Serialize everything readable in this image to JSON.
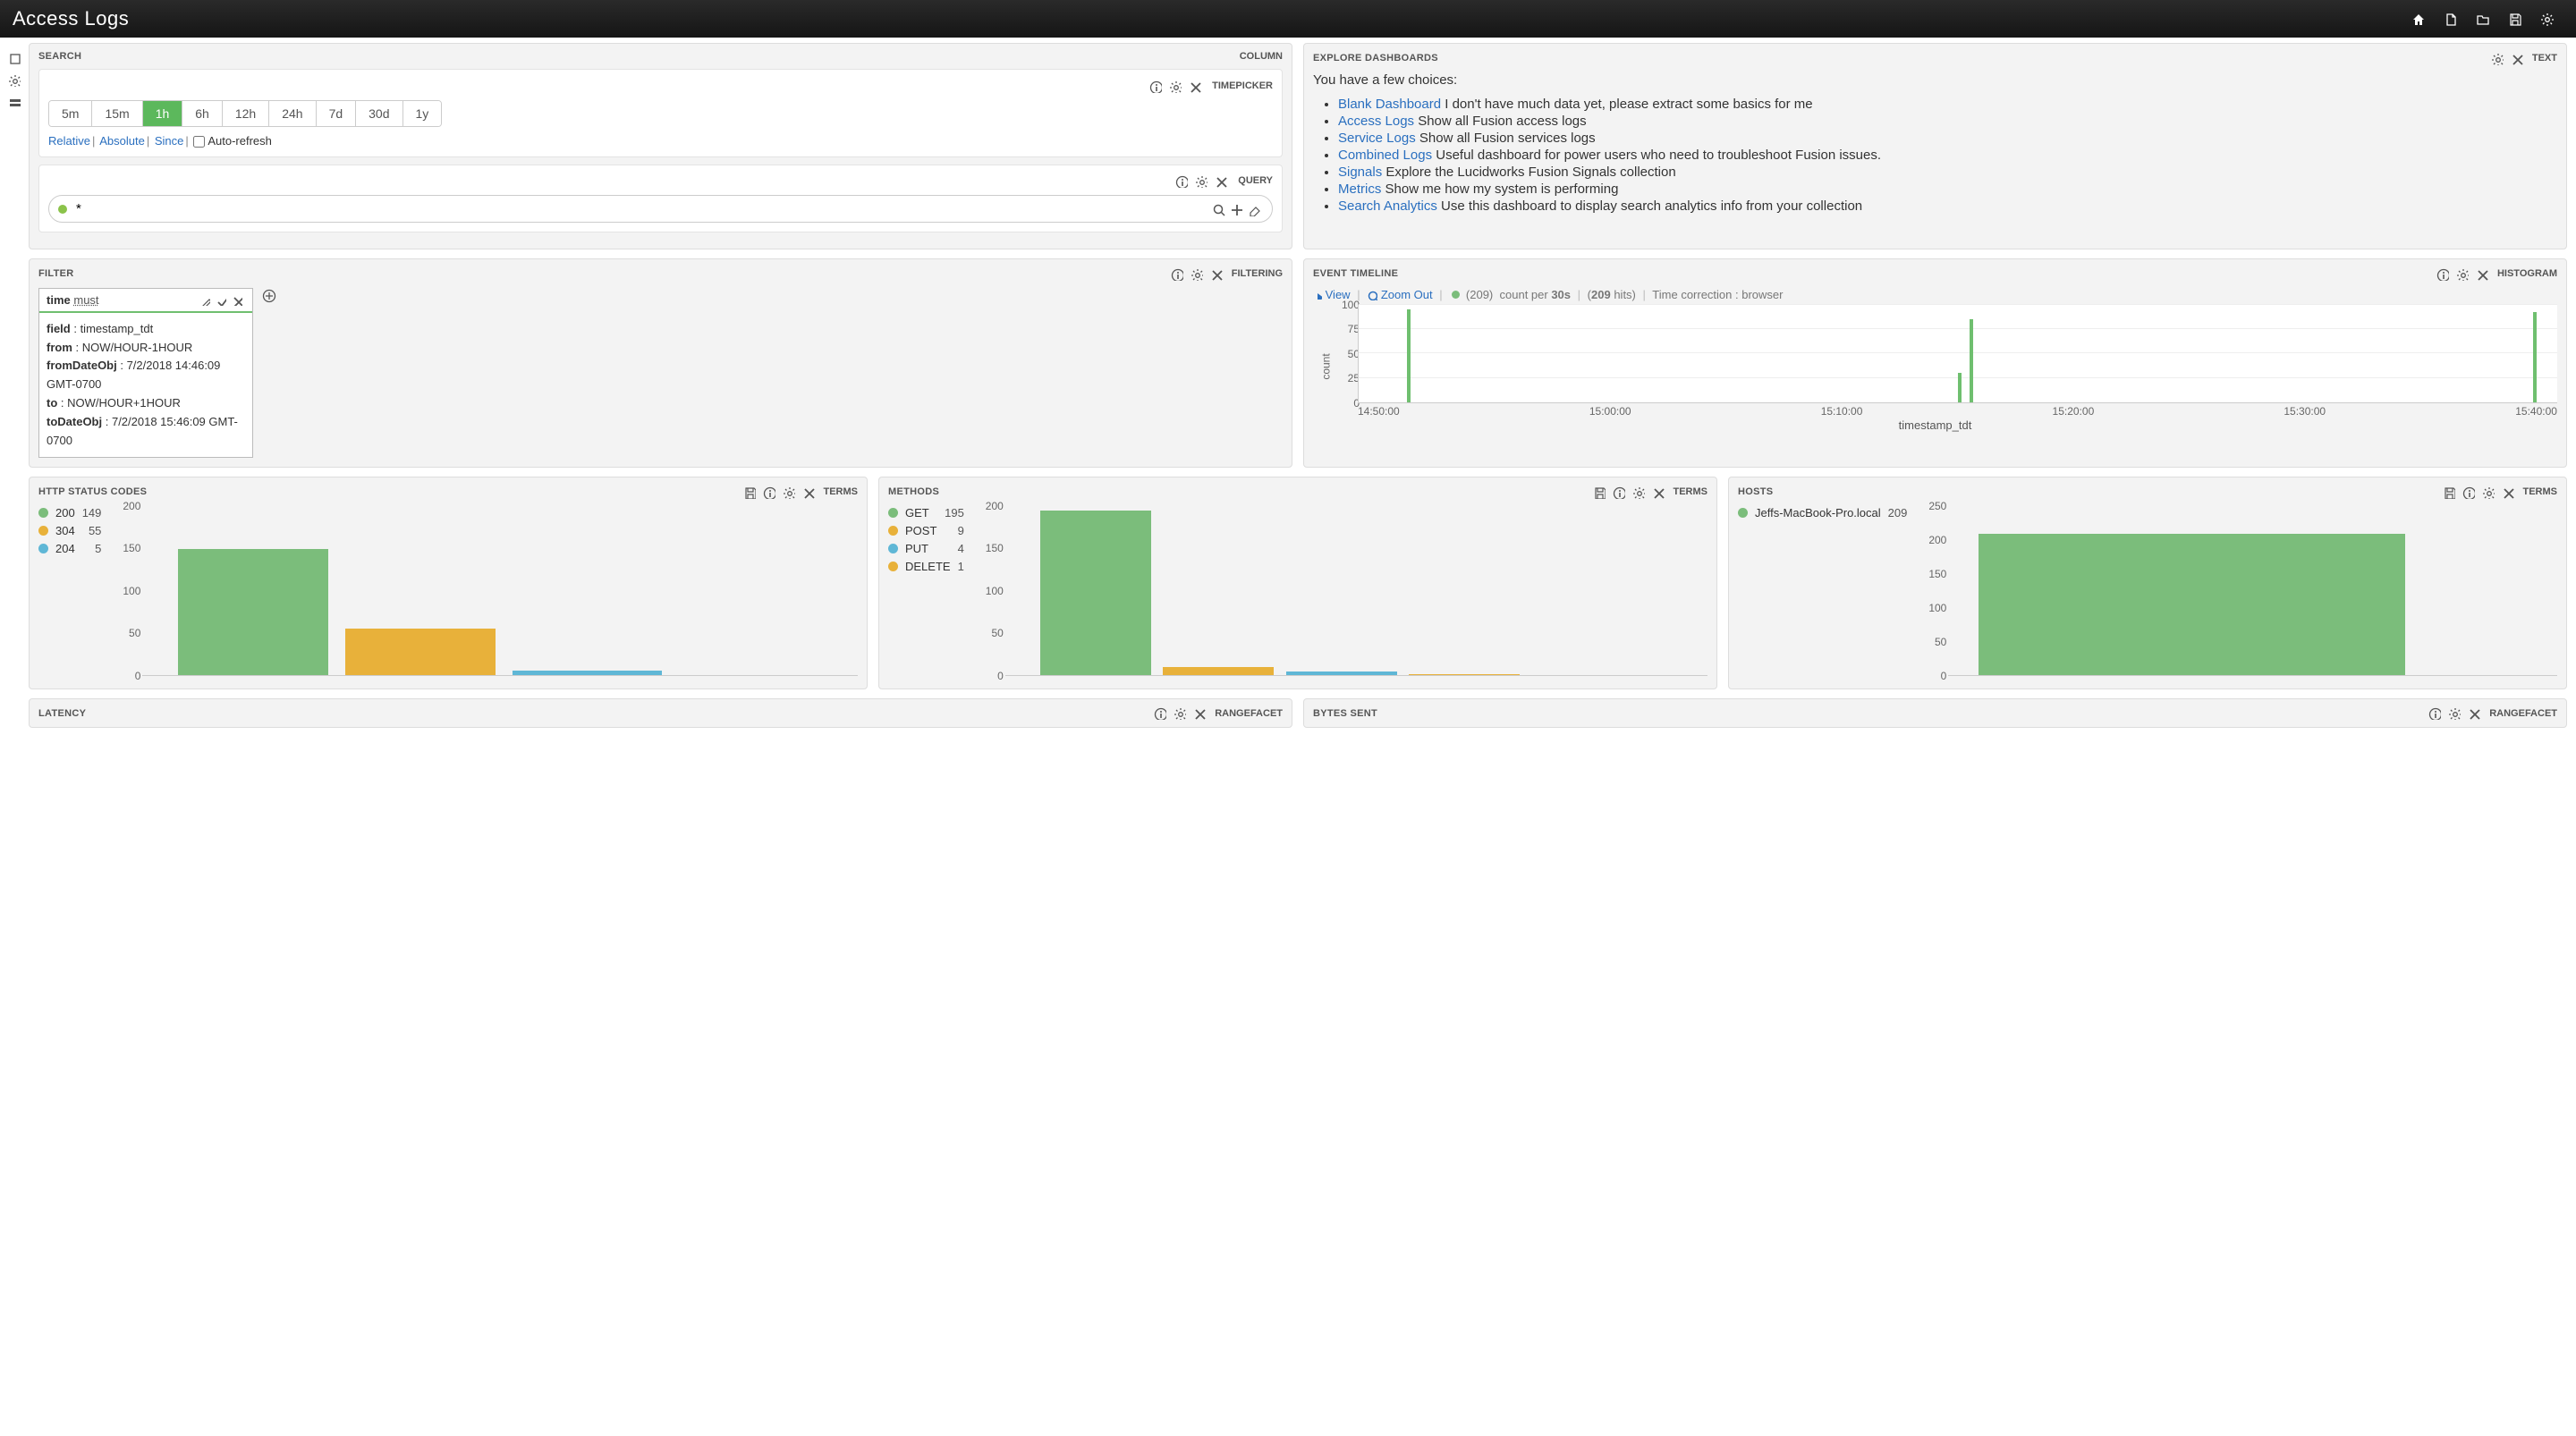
{
  "header": {
    "title": "Access Logs"
  },
  "search": {
    "panel_title": "SEARCH",
    "panel_type": "COLUMN",
    "timepicker": {
      "type_label": "TIMEPICKER",
      "ranges": [
        "5m",
        "15m",
        "1h",
        "6h",
        "12h",
        "24h",
        "7d",
        "30d",
        "1y"
      ],
      "active": "1h",
      "mode_links": {
        "relative": "Relative",
        "absolute": "Absolute",
        "since": "Since"
      },
      "autorefresh_label": "Auto-refresh"
    },
    "query": {
      "type_label": "QUERY",
      "value": "*"
    }
  },
  "explore": {
    "panel_title": "EXPLORE DASHBOARDS",
    "panel_type": "TEXT",
    "intro": "You have a few choices:",
    "items": [
      {
        "link": "Blank Dashboard",
        "text": " I don't have much data yet, please extract some basics for me"
      },
      {
        "link": "Access Logs",
        "text": " Show all Fusion access logs"
      },
      {
        "link": "Service Logs",
        "text": " Show all Fusion services logs"
      },
      {
        "link": "Combined Logs",
        "text": " Useful dashboard for power users who need to troubleshoot Fusion issues."
      },
      {
        "link": "Signals",
        "text": " Explore the Lucidworks Fusion Signals collection"
      },
      {
        "link": "Metrics",
        "text": " Show me how my system is performing"
      },
      {
        "link": "Search Analytics",
        "text": " Use this dashboard to display search analytics info from your collection"
      }
    ]
  },
  "filter": {
    "panel_title": "FILTER",
    "panel_type": "FILTERING",
    "card": {
      "prefix": "time",
      "must": "must",
      "rows": [
        {
          "k": "field",
          "v": "timestamp_tdt"
        },
        {
          "k": "from",
          "v": "NOW/HOUR-1HOUR"
        },
        {
          "k": "fromDateObj",
          "v": "7/2/2018 14:46:09 GMT-0700"
        },
        {
          "k": "to",
          "v": "NOW/HOUR+1HOUR"
        },
        {
          "k": "toDateObj",
          "v": "7/2/2018 15:46:09 GMT-0700"
        }
      ]
    }
  },
  "timeline": {
    "panel_title": "EVENT TIMELINE",
    "panel_type": "HISTOGRAM",
    "controls": {
      "view": "View",
      "zoom": "Zoom Out",
      "count_paren": "(209)",
      "count_per": "count per",
      "interval": "30s",
      "hits_paren_open": "(",
      "hits_val": "209",
      "hits_label": " hits)",
      "tc": "Time correction : browser"
    },
    "ylabel": "count",
    "xlabel": "timestamp_tdt"
  },
  "http": {
    "panel_title": "HTTP STATUS CODES",
    "panel_type": "TERMS",
    "legend": [
      {
        "label": "200",
        "value": 149,
        "color": "#7bbd7b"
      },
      {
        "label": "304",
        "value": 55,
        "color": "#e8b13a"
      },
      {
        "label": "204",
        "value": 5,
        "color": "#5fb7d6"
      }
    ]
  },
  "methods": {
    "panel_title": "METHODS",
    "panel_type": "TERMS",
    "legend": [
      {
        "label": "GET",
        "value": 195,
        "color": "#7bbd7b"
      },
      {
        "label": "POST",
        "value": 9,
        "color": "#e8b13a"
      },
      {
        "label": "PUT",
        "value": 4,
        "color": "#5fb7d6"
      },
      {
        "label": "DELETE",
        "value": 1,
        "color": "#e8b13a"
      }
    ]
  },
  "hosts": {
    "panel_title": "HOSTS",
    "panel_type": "TERMS",
    "legend": [
      {
        "label": "Jeffs-MacBook-Pro.local",
        "value": 209,
        "color": "#7bbd7b"
      }
    ]
  },
  "latency": {
    "panel_title": "LATENCY",
    "panel_type": "RANGEFACET"
  },
  "bytes": {
    "panel_title": "BYTES SENT",
    "panel_type": "RANGEFACET"
  },
  "chart_data": [
    {
      "type": "bar",
      "name": "event_timeline",
      "xlabel": "timestamp_tdt",
      "ylabel": "count",
      "ylim": [
        0,
        100
      ],
      "interval": "30s",
      "total_hits": 209,
      "x_ticks": [
        "14:50:00",
        "15:00:00",
        "15:10:00",
        "15:20:00",
        "15:30:00",
        "15:40:00"
      ],
      "bars": [
        {
          "x_pct": 4,
          "value": 95
        },
        {
          "x_pct": 50,
          "value": 30
        },
        {
          "x_pct": 51,
          "value": 85
        },
        {
          "x_pct": 98,
          "value": 92
        }
      ]
    },
    {
      "type": "bar",
      "name": "http_status_codes",
      "ylim": [
        0,
        200
      ],
      "categories": [
        "200",
        "304",
        "204"
      ],
      "values": [
        149,
        55,
        5
      ],
      "colors": [
        "#7bbd7b",
        "#e8b13a",
        "#5fb7d6"
      ]
    },
    {
      "type": "bar",
      "name": "methods",
      "ylim": [
        0,
        200
      ],
      "categories": [
        "GET",
        "POST",
        "PUT",
        "DELETE"
      ],
      "values": [
        195,
        9,
        4,
        1
      ],
      "colors": [
        "#7bbd7b",
        "#e8b13a",
        "#5fb7d6",
        "#e8b13a"
      ]
    },
    {
      "type": "bar",
      "name": "hosts",
      "ylim": [
        0,
        250
      ],
      "categories": [
        "Jeffs-MacBook-Pro.local"
      ],
      "values": [
        209
      ],
      "colors": [
        "#7bbd7b"
      ]
    }
  ]
}
